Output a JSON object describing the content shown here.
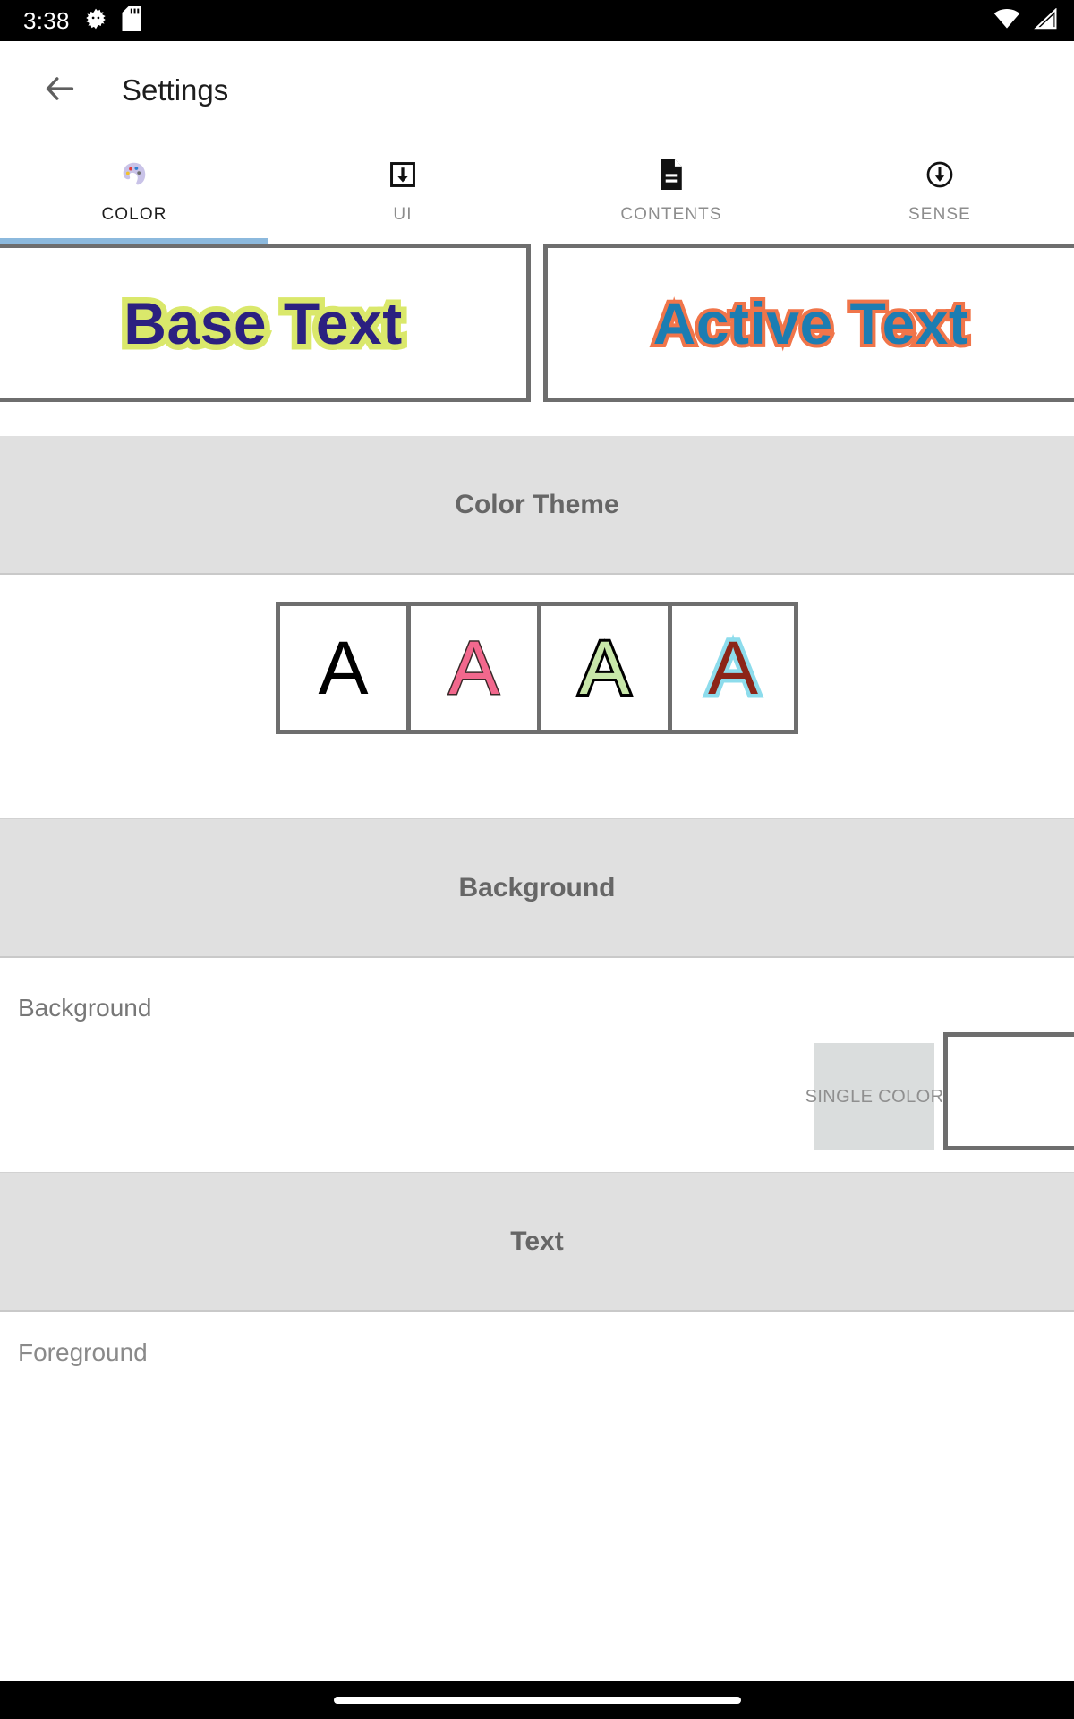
{
  "statusbar": {
    "clock": "3:38",
    "icons_left": [
      "android-gear-icon",
      "sd-card-icon"
    ],
    "icons_right": [
      "wifi-icon",
      "cell-signal-icon"
    ]
  },
  "appbar": {
    "back_icon": "back-arrow-icon",
    "title": "Settings"
  },
  "tabs": [
    {
      "label": "COLOR",
      "icon": "palette-icon",
      "active": true
    },
    {
      "label": "UI",
      "icon": "box-arrow-down-icon",
      "active": false
    },
    {
      "label": "CONTENTS",
      "icon": "document-icon",
      "active": false
    },
    {
      "label": "SENSE",
      "icon": "circle-arrow-down-icon",
      "active": false
    }
  ],
  "tab_indicator_color": "#8cb9dd",
  "preview": {
    "base": {
      "text": "Base Text",
      "fill_color": "#2b2080",
      "outline_color": "#dae86b"
    },
    "active": {
      "text": "Active Text",
      "fill_color": "#1c7db2",
      "outline_color": "#f0754a"
    }
  },
  "sections": {
    "color_theme": {
      "header": "Color Theme",
      "swatches": [
        {
          "letter": "A",
          "fill_color": "#000000",
          "outline_color": "none",
          "selected": true
        },
        {
          "letter": "A",
          "fill_color": "#f2688d",
          "outline_color": "#3a2a2a",
          "selected": false
        },
        {
          "letter": "A",
          "fill_color": "#c8e7a9",
          "outline_color": "#000000",
          "selected": false
        },
        {
          "letter": "A",
          "fill_color": "#8c2518",
          "outline_color": "#8ddcec",
          "selected": false
        }
      ]
    },
    "background": {
      "header": "Background",
      "rows": [
        {
          "label": "Background",
          "chip_label": "SINGLE COLOR",
          "color_value": "#ffffff"
        }
      ]
    },
    "text": {
      "header": "Text",
      "rows": [
        {
          "label": "Foreground"
        }
      ]
    }
  },
  "navbar": {
    "pill": "home-gesture-pill"
  }
}
